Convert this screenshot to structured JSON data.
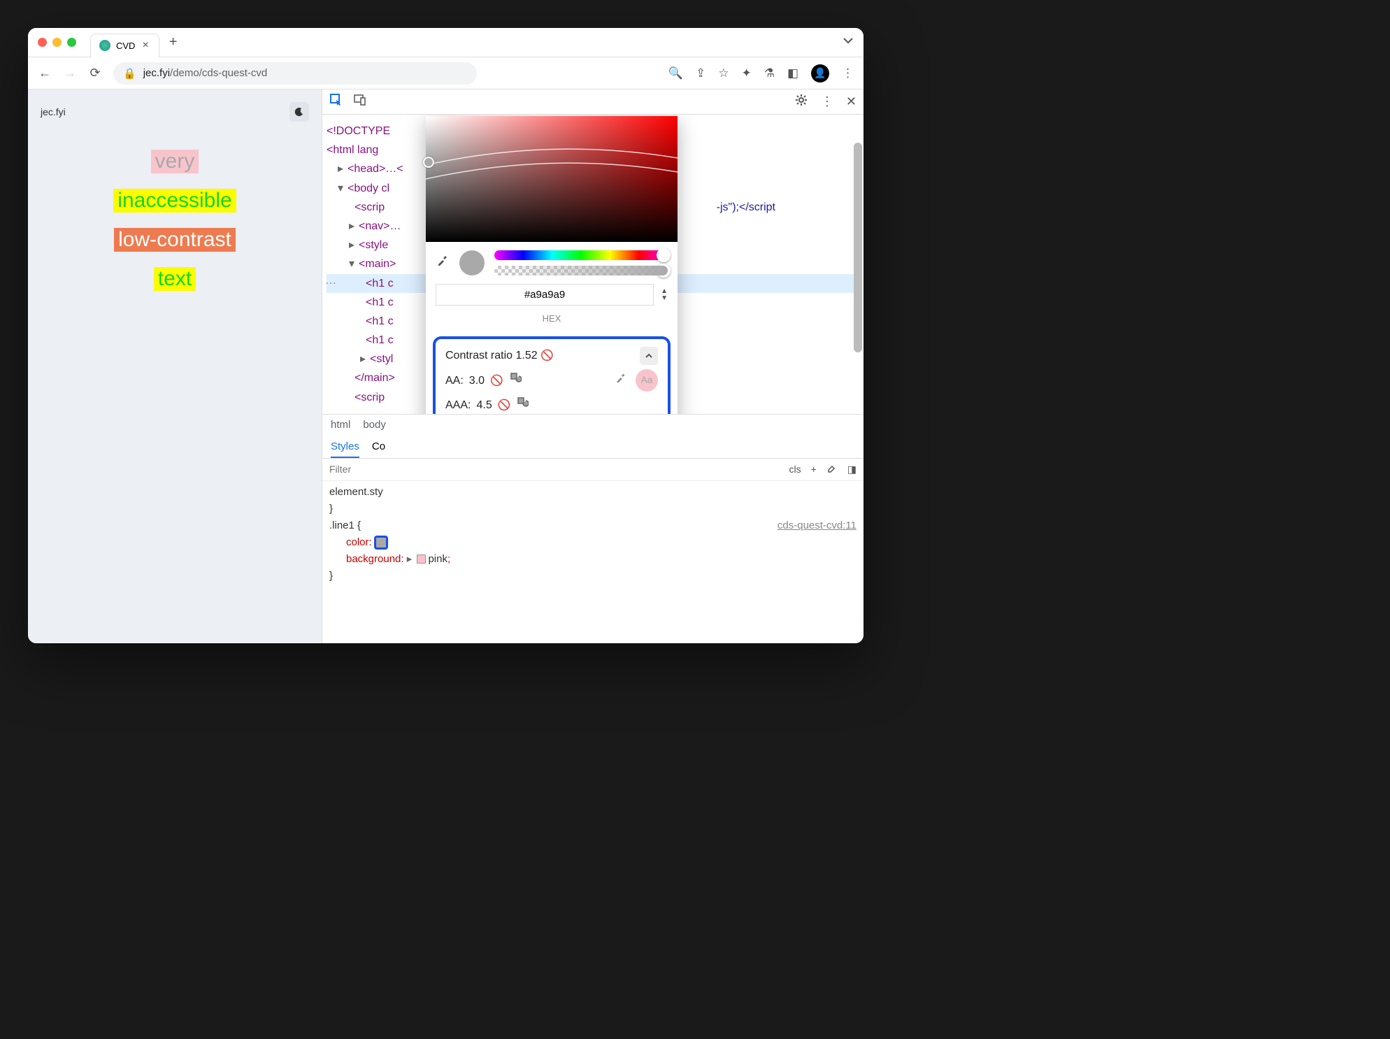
{
  "tab": {
    "title": "CVD"
  },
  "url": {
    "domain": "jec.fyi",
    "path": "/demo/cds-quest-cvd"
  },
  "page": {
    "site_label": "jec.fyi",
    "words": [
      "very",
      "inaccessible",
      "low-contrast",
      "text"
    ]
  },
  "dom": {
    "doctype": "<!DOCTYPE",
    "html_open": "<html lang",
    "head": "<head>…<",
    "body_open": "<body cl",
    "script_frag_open": "<scrip",
    "script_frag_end": "-js\");</script",
    "nav": "<nav>…",
    "style": "<style",
    "main_open": "<main>",
    "h1": "<h1 c",
    "style_close": "<styl",
    "main_close": "</main>",
    "script_close": "<scrip"
  },
  "breadcrumb": {
    "html": "html",
    "body": "body"
  },
  "styles": {
    "tab_styles": "Styles",
    "tab_computed": "Co",
    "filter_placeholder": "Filter",
    "cls": "cls",
    "element_style": "element.sty",
    "rule_selector": ".line1 {",
    "src_link": "cds-quest-cvd:11",
    "prop_color": "color",
    "prop_background": "background",
    "val_background": "pink",
    "brace": "}"
  },
  "picker": {
    "hex_value": "#a9a9a9",
    "hex_label": "HEX",
    "contrast_label": "Contrast ratio",
    "contrast_value": "1.52",
    "aa_label": "AA:",
    "aa_value": "3.0",
    "aaa_label": "AAA:",
    "aaa_value": "4.5",
    "aa_badge": "Aa",
    "palette": [
      "#e91e63",
      "#9c27b0",
      "#2c3e50",
      "#34495e",
      "#607d8b",
      "#546e7a",
      "#455a64",
      "#2962ff",
      "#01579b",
      "#006064",
      "#26a69a",
      "#2e7d32",
      "#827717",
      "#ef6c00",
      "#fafafa",
      "#eeeeee",
      "#f5f5f5",
      "#ffffff",
      "#eceff1",
      "#e0e0e0",
      "#bdbdbd",
      "#000000",
      "#cccccc",
      "#dddddd"
    ]
  }
}
